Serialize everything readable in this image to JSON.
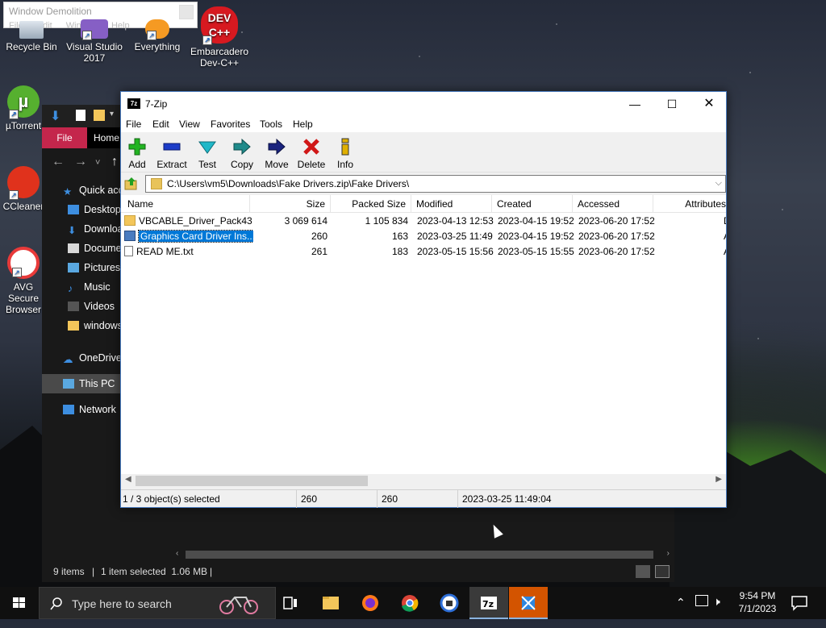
{
  "window_demolition": {
    "title": "Window Demolition",
    "menu": "File  Edit  Window  Help"
  },
  "desktop_icons": [
    {
      "label": "Recycle Bin"
    },
    {
      "label": "Visual Studio 2017"
    },
    {
      "label": "Everything"
    },
    {
      "label": "Embarcadero Dev-C++"
    },
    {
      "label": "µTorrent"
    },
    {
      "label": "CCleaner"
    },
    {
      "label": "AVG Secure Browser"
    }
  ],
  "explorer": {
    "tabs": {
      "file": "File",
      "home": "Home"
    },
    "nav": [
      {
        "label": "Quick access"
      },
      {
        "label": "Desktop"
      },
      {
        "label": "Downloads"
      },
      {
        "label": "Documents"
      },
      {
        "label": "Pictures"
      },
      {
        "label": "Music"
      },
      {
        "label": "Videos"
      },
      {
        "label": "windows"
      },
      {
        "label": "OneDrive"
      },
      {
        "label": "This PC"
      },
      {
        "label": "Network"
      }
    ],
    "status": {
      "items": "9 items",
      "selected": "1 item selected  1.06 MB"
    }
  },
  "zip": {
    "title": "7-Zip",
    "app_icon": "7z",
    "menu": [
      "File",
      "Edit",
      "View",
      "Favorites",
      "Tools",
      "Help"
    ],
    "toolbar": [
      {
        "label": "Add",
        "icon": "plus-icon",
        "color": "#22b422"
      },
      {
        "label": "Extract",
        "icon": "minus-icon",
        "color": "#1c3cc8"
      },
      {
        "label": "Test",
        "icon": "check-icon",
        "color": "#20b8c8"
      },
      {
        "label": "Copy",
        "icon": "arrow-right-icon",
        "color": "#1f8a8a"
      },
      {
        "label": "Move",
        "icon": "arrow-right-icon",
        "color": "#1a237e"
      },
      {
        "label": "Delete",
        "icon": "x-icon",
        "color": "#d01818"
      },
      {
        "label": "Info",
        "icon": "info-icon",
        "color": "#e0b000"
      }
    ],
    "path": "C:\\Users\\vm5\\Downloads\\Fake Drivers.zip\\Fake Drivers\\",
    "columns": [
      "Name",
      "Size",
      "Packed Size",
      "Modified",
      "Created",
      "Accessed",
      "Attributes"
    ],
    "rows": [
      {
        "name": "VBCABLE_Driver_Pack43",
        "size": "3 069 614",
        "packed": "1 105 834",
        "modified": "2023-04-13 12:53",
        "created": "2023-04-15 19:52",
        "accessed": "2023-06-20 17:52",
        "attr": "D",
        "type": "folder",
        "selected": false
      },
      {
        "name": "Graphics Card Driver Ins...",
        "size": "260",
        "packed": "163",
        "modified": "2023-03-25 11:49",
        "created": "2023-04-15 19:52",
        "accessed": "2023-06-20 17:52",
        "attr": "A",
        "type": "shortcut",
        "selected": true
      },
      {
        "name": "READ ME.txt",
        "size": "261",
        "packed": "183",
        "modified": "2023-05-15 15:56",
        "created": "2023-05-15 15:55",
        "accessed": "2023-06-20 17:52",
        "attr": "A",
        "type": "text",
        "selected": false
      }
    ],
    "status": {
      "selection": "1 / 3 object(s) selected",
      "size": "260",
      "packed": "260",
      "modified": "2023-03-25 11:49:04"
    }
  },
  "taskbar": {
    "search_placeholder": "Type here to search",
    "time": "9:54 PM",
    "date": "7/1/2023"
  }
}
